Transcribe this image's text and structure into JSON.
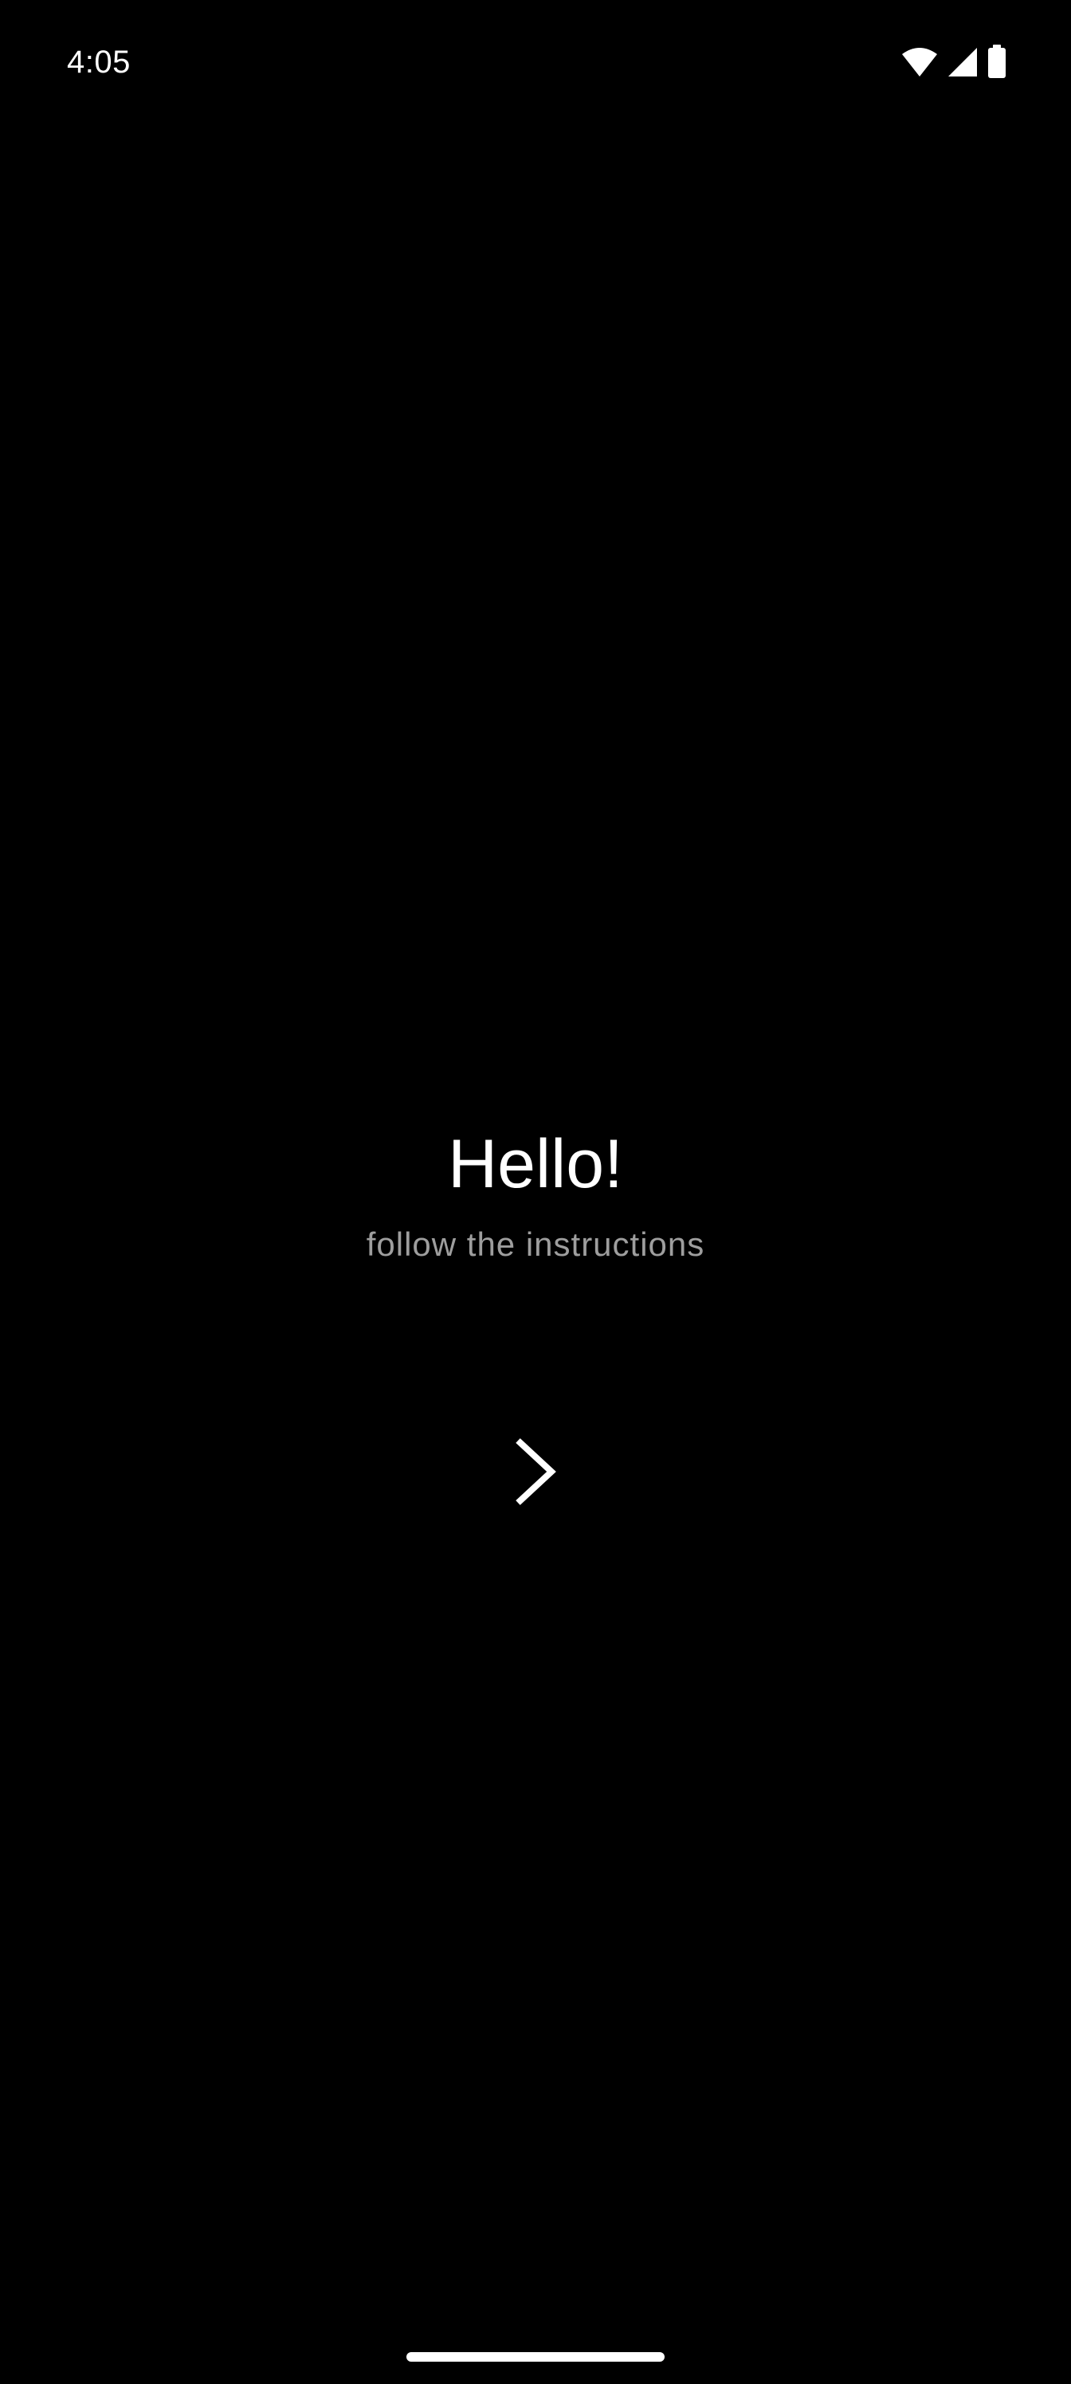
{
  "status_bar": {
    "time": "4:05",
    "icons": [
      "wifi-icon",
      "cellular-signal-icon",
      "battery-icon"
    ]
  },
  "welcome": {
    "title": "Hello!",
    "subtitle": "follow the instructions"
  },
  "next_button": {
    "icon": "chevron-right-icon"
  },
  "colors": {
    "background": "#000000",
    "title": "#ffffff",
    "subtitle": "#9e9e9e",
    "icon": "#ffffff"
  }
}
